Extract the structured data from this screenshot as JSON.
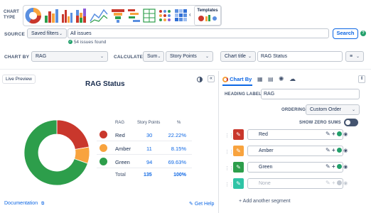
{
  "colors": {
    "red": "#c9372c",
    "amber": "#f8a33e",
    "green": "#2d9e4b",
    "teal": "#2fc4a6",
    "link": "#0c66e4"
  },
  "header": {
    "chart_type_label": "CHART TYPE",
    "templates_label": "Templates"
  },
  "source": {
    "label": "SOURCE",
    "saved_filters": "Saved filters",
    "query": "All issues",
    "status": "54 issues found",
    "search_button": "Search"
  },
  "chart_by": {
    "label": "CHART BY",
    "value": "RAG",
    "calculate_label": "CALCULATE",
    "calc_fn": "Sum",
    "calc_field": "Story Points",
    "title_mode": "Chart title",
    "title_value": "RAG Status"
  },
  "preview": {
    "label": "Live Preview",
    "title": "RAG Status",
    "documentation": "Documentation",
    "get_help": "Get Help"
  },
  "table": {
    "headers": [
      "RAG",
      "Story Points",
      "%"
    ],
    "rows": [
      {
        "name": "Red",
        "points": "30",
        "pct": "22.22%"
      },
      {
        "name": "Amber",
        "points": "11",
        "pct": "8.15%"
      },
      {
        "name": "Green",
        "points": "94",
        "pct": "69.63%"
      }
    ],
    "total": {
      "name": "Total",
      "points": "135",
      "pct": "100%"
    }
  },
  "chart_data": {
    "type": "pie",
    "title": "RAG Status",
    "categories": [
      "Red",
      "Amber",
      "Green"
    ],
    "values": [
      30,
      11,
      94
    ],
    "colors": [
      "#c9372c",
      "#f8a33e",
      "#2d9e4b"
    ],
    "donut": true
  },
  "panel": {
    "tab_label": "Chart By",
    "heading_label": "HEADING LABEL",
    "heading_value": "RAG",
    "ordering_label": "ORDERING",
    "ordering_value": "Custom Order",
    "zero_sums_label": "SHOW ZERO SUMS",
    "segments": [
      {
        "name": "Red",
        "color": "#c9372c"
      },
      {
        "name": "Amber",
        "color": "#f8a33e"
      },
      {
        "name": "Green",
        "color": "#2d9e4b"
      }
    ],
    "none_placeholder": "None",
    "add_segment": "Add another segment"
  }
}
